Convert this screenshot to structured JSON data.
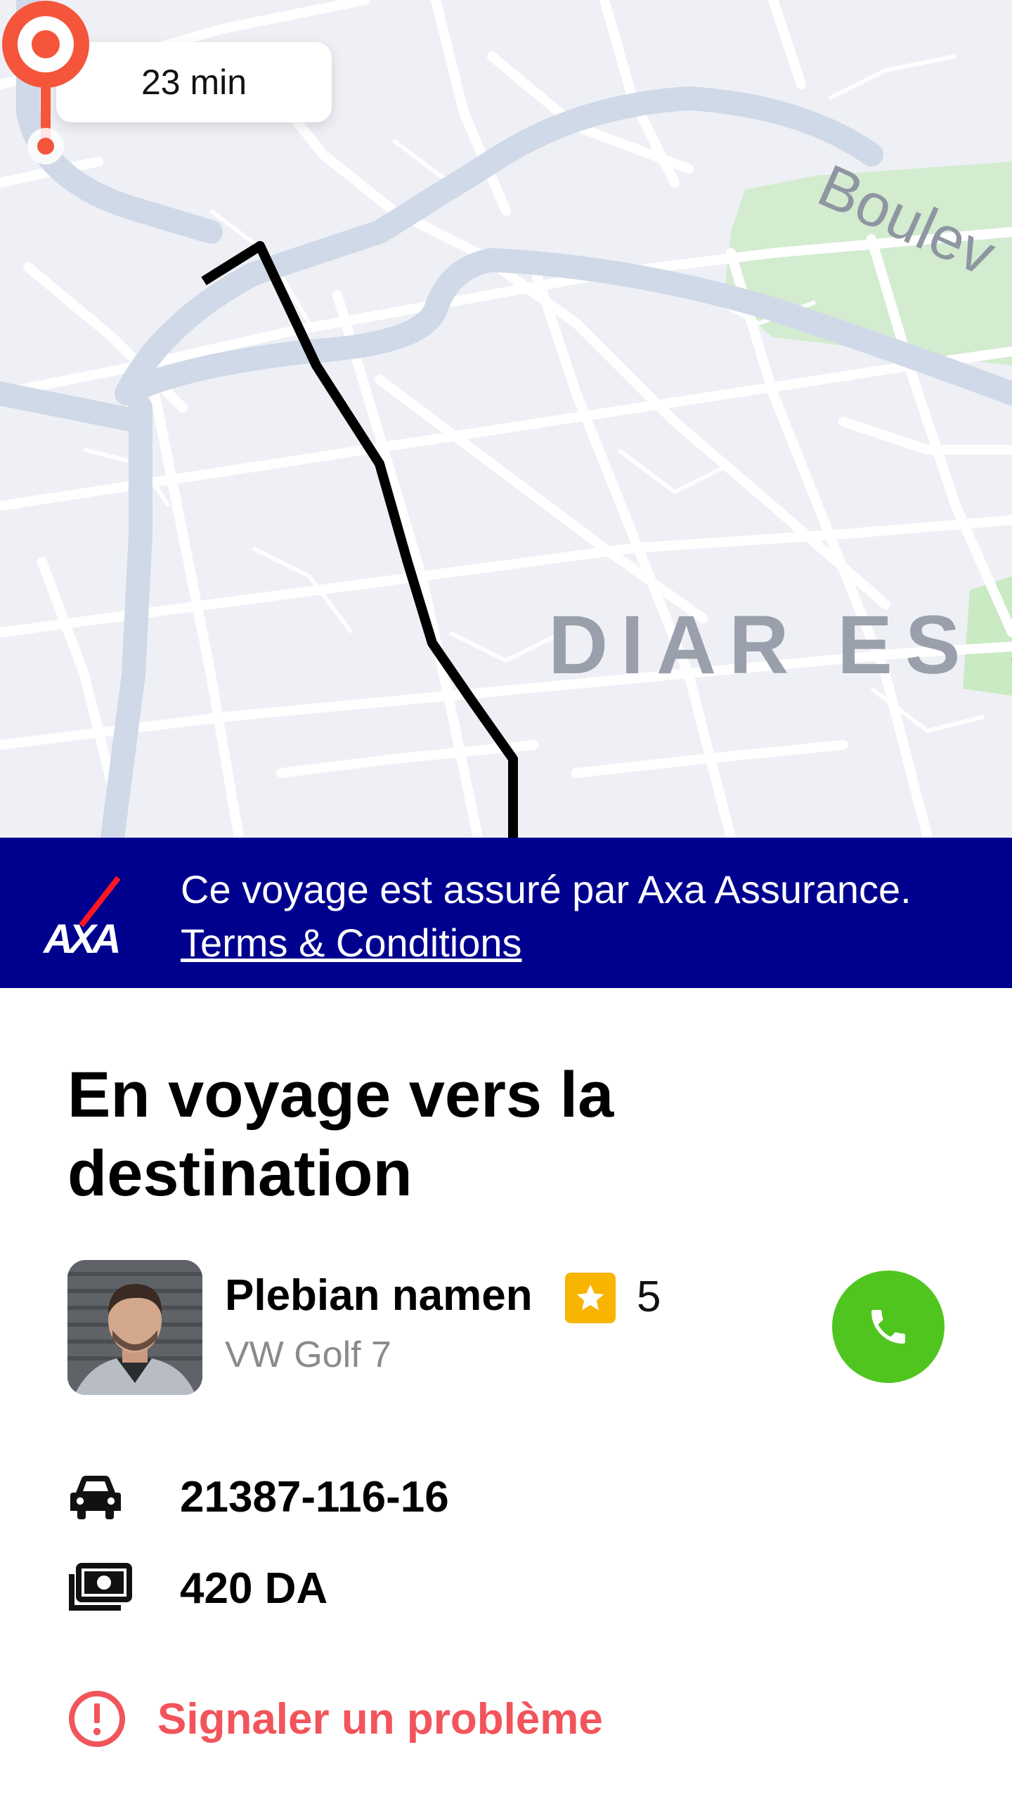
{
  "map": {
    "eta": "23 min",
    "area_label": "DIAR ES S",
    "street_label": "Boulev",
    "colors": {
      "background": "#eef0f5",
      "road": "#ffffff",
      "highway": "#d0d9e8",
      "park": "#d3ecd0",
      "route": "#000000",
      "pin": "#f4553b"
    }
  },
  "banner": {
    "text": "Ce voyage est assuré par Axa Assurance. ",
    "link": "Terms & Conditions",
    "logo_text": "AXA",
    "color": "#00008f"
  },
  "trip": {
    "title": "En voyage vers la destination"
  },
  "driver": {
    "name": "Plebian namen",
    "rating": "5",
    "car_model": "VW Golf 7",
    "avatar_icon": "driver-photo"
  },
  "details": {
    "plate": "21387-116-16",
    "fare": "420 DA",
    "plate_icon": "car-icon",
    "fare_icon": "money-icon"
  },
  "actions": {
    "call_icon": "phone-icon",
    "call_color": "#50c51f",
    "report_label": "Signaler un problème",
    "report_color": "#f2545b"
  }
}
